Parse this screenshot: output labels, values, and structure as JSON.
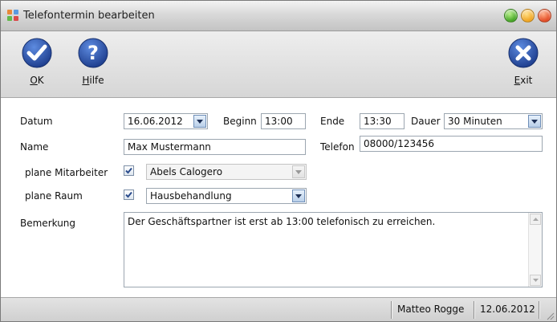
{
  "window": {
    "title": "Telefontermin bearbeiten",
    "icon_colors": [
      "#e8883a",
      "#5a9ae0",
      "#63b84a",
      "#d94a4a"
    ],
    "controls": [
      "minimize-icon",
      "maximize-icon",
      "close-icon"
    ]
  },
  "toolbar": {
    "ok_label": "OK",
    "help_label": "Hilfe",
    "exit_label": "Exit",
    "accent": "#2e55a8"
  },
  "form": {
    "datum_label": "Datum",
    "datum_value": "16.06.2012",
    "beginn_label": "Beginn",
    "beginn_value": "13:00",
    "ende_label": "Ende",
    "ende_value": "13:30",
    "dauer_label": "Dauer",
    "dauer_value": "30 Minuten",
    "name_label": "Name",
    "name_value": "Max Mustermann",
    "telefon_label": "Telefon",
    "telefon_value": "08000/123456",
    "mitarbeiter_label": "plane Mitarbeiter",
    "mitarbeiter_checked": true,
    "mitarbeiter_value": "Abels Calogero",
    "raum_label": "plane Raum",
    "raum_checked": true,
    "raum_value": "Hausbehandlung",
    "bemerkung_label": "Bemerkung",
    "bemerkung_value": "Der Geschäftspartner ist erst ab 13:00 telefonisch zu erreichen."
  },
  "status": {
    "user": "Matteo Rogge",
    "date": "12.06.2012"
  }
}
